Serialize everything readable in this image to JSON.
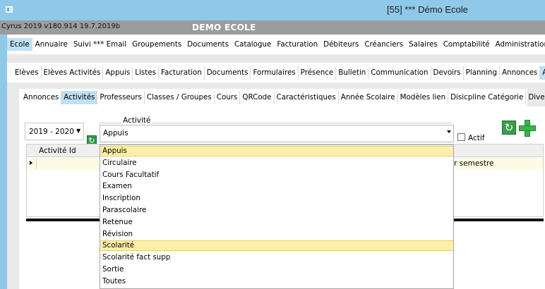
{
  "window": {
    "title": "[55] *** Démo Ecole"
  },
  "infobar": {
    "version": "Cyrus 2019 v180.914 19.7.2019b",
    "app_name": "DEMO ECOLE"
  },
  "main_menu": [
    "Ecole",
    "Annuaire",
    "Suivi *** Email",
    "Groupements",
    "Documents",
    "Catalogue",
    "Facturation",
    "Débiteurs",
    "Créanciers",
    "Salaires",
    "Comptabilité",
    "Administration"
  ],
  "second_nav": [
    "Elèves",
    "Elèves Activités",
    "Appuis",
    "Listes",
    "Facturation",
    "Documents",
    "Formulaires",
    "Présence",
    "Bulletin",
    "Communication",
    "Devoirs",
    "Planning",
    "Annonces",
    "Admin"
  ],
  "third_nav": [
    "Annonces",
    "Activités",
    "Professeurs",
    "Classes / Groupes",
    "Cours",
    "QRCode",
    "Caractéristiques",
    "Année Scolaire",
    "Modèles lien",
    "Disicpline Catégorie",
    "Divers"
  ],
  "year_combo": {
    "value": "2019 - 2020"
  },
  "activity": {
    "label": "Activité",
    "value": "Appuis"
  },
  "actif": {
    "label": "Actif",
    "checked": false
  },
  "grid": {
    "column": "Activité Id",
    "visible_cell": "r semestre"
  },
  "dropdown": [
    "Appuis",
    "Circulaire",
    "Cours Facultatif",
    "Examen",
    "Inscription",
    "Parascolaire",
    "Retenue",
    "Révision",
    "Scolarité",
    "Scolarité fact supp",
    "Sortie",
    "Toutes"
  ],
  "colors": {
    "titlebar": "#8fc9ea",
    "active_tab": "#bfe0f5",
    "highlight": "#fdf0a6",
    "add_green": "#39b54a"
  },
  "icons": {
    "refresh": "refresh-icon",
    "add": "plus-icon"
  }
}
